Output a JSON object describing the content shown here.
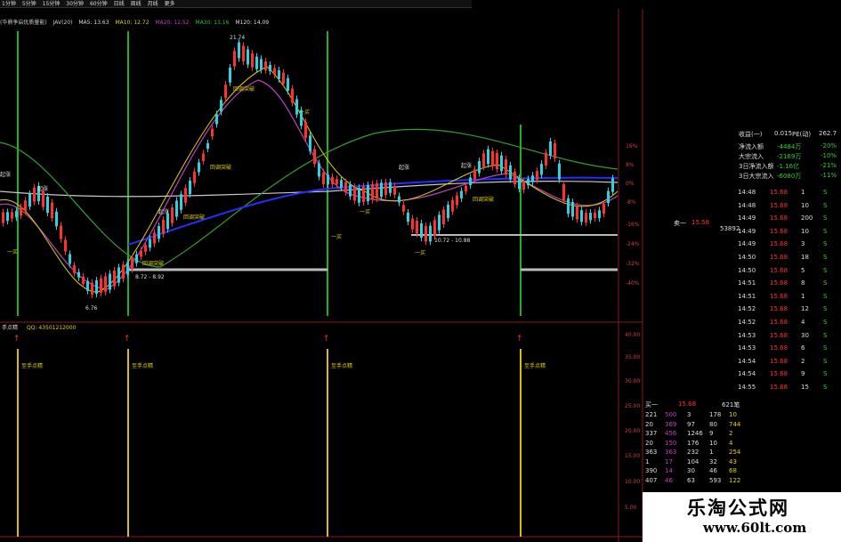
{
  "top_menu": [
    "1分钟",
    "5分钟",
    "15分钟",
    "30分钟",
    "60分钟",
    "日线",
    "周线",
    "月线",
    "更多"
  ],
  "indicator_line": {
    "name": "(华鼎争启优质量能)",
    "j": "JAV(20)",
    "ma5": "MA5: 13.63",
    "ma10": "MA10: 12.72",
    "ma20": "MA20: 12.52",
    "ma30": "MA30: 13.16",
    "m120": "M120: 14.09"
  },
  "price_labels": {
    "high": "21.74",
    "low": "6.76",
    "range1": "8.72 - 8.92",
    "range2": "10.72 - 10.88"
  },
  "signal_labels": {
    "breakout": "回调突破",
    "rise": "起涨",
    "buy": "一买",
    "buy2": "二买"
  },
  "y_axis_upper": [
    "16%",
    "8%",
    "0%",
    "-8%",
    "-16%",
    "-24%",
    "-32%",
    "-40%"
  ],
  "y_axis_lower": [
    "40.00",
    "35.00",
    "30.00",
    "25.00",
    "20.00",
    "15.00",
    "10.00",
    "5.00"
  ],
  "lower_panel": {
    "title": "手点精",
    "qq": "QQ: 43501212000",
    "signal": "至手点精"
  },
  "right_panel": {
    "info_rows": [
      {
        "label": "收益(一)",
        "v1": "0.015",
        "label2": "PE(动)",
        "v2": "262.7"
      },
      {
        "label": "净流入额",
        "v1": "-4484万",
        "v2": "-20%"
      },
      {
        "label": "大宗流入",
        "v1": "-2169万",
        "v2": "-10%"
      },
      {
        "label": "3日净流入额",
        "v1": "-1.16亿",
        "v2": "-21%"
      },
      {
        "label": "3日大宗流入",
        "v1": "-6080万",
        "v2": "-11%"
      }
    ],
    "ticks": [
      {
        "t": "14:48",
        "p": "15.68",
        "v": "1",
        "s": "S"
      },
      {
        "t": "14:48",
        "p": "15.68",
        "v": "10",
        "s": "S"
      },
      {
        "t": "14:49",
        "p": "15.68",
        "v": "200",
        "s": "S"
      },
      {
        "t": "14:49",
        "p": "15.68",
        "v": "10",
        "s": "S"
      },
      {
        "t": "14:49",
        "p": "15.68",
        "v": "3",
        "s": "S"
      },
      {
        "t": "14:50",
        "p": "15.68",
        "v": "18",
        "s": "S"
      },
      {
        "t": "14:50",
        "p": "15.68",
        "v": "5",
        "s": "S"
      },
      {
        "t": "14:51",
        "p": "15.68",
        "v": "8",
        "s": "S"
      },
      {
        "t": "14:51",
        "p": "15.68",
        "v": "1",
        "s": "S"
      },
      {
        "t": "14:52",
        "p": "15.68",
        "v": "12",
        "s": "S"
      },
      {
        "t": "14:52",
        "p": "15.68",
        "v": "4",
        "s": "S"
      },
      {
        "t": "14:53",
        "p": "15.68",
        "v": "30",
        "s": "S"
      },
      {
        "t": "14:53",
        "p": "15.68",
        "v": "6",
        "s": "S"
      },
      {
        "t": "14:54",
        "p": "15.68",
        "v": "2",
        "s": "S"
      },
      {
        "t": "14:54",
        "p": "15.68",
        "v": "9",
        "s": "S"
      },
      {
        "t": "14:55",
        "p": "15.68",
        "v": "15",
        "s": "S"
      }
    ],
    "order_rows": [
      [
        "221",
        "500",
        "3",
        "178",
        "10"
      ],
      [
        "20",
        "369",
        "97",
        "80",
        "744"
      ],
      [
        "337",
        "456",
        "1246",
        "9",
        "2"
      ],
      [
        "20",
        "150",
        "176",
        "10",
        "4"
      ],
      [
        "363",
        "363",
        "232",
        "1",
        "254"
      ],
      [
        "1",
        "17",
        "104",
        "32",
        "43"
      ],
      [
        "390",
        "14",
        "30",
        "46",
        "68"
      ],
      [
        "407",
        "46",
        "63",
        "593",
        "122"
      ]
    ],
    "buy_label": "买一",
    "buy_price": "15.68",
    "buy_vol": "621笔",
    "side_label": "卖一",
    "side_price": "15.58",
    "side_vol": "53892"
  },
  "watermark": {
    "name": "乐淘公式网",
    "url": "www.60lt.com"
  },
  "colors": {
    "up": "#ff3030",
    "down": "#30d0e0",
    "signal_green": "#20c020",
    "signal_yellow": "#d8c000",
    "ma_purple": "#c040c0",
    "ma_blue": "#2030ff",
    "ma_green": "#30a030",
    "ma_white": "#c8c8c8"
  }
}
